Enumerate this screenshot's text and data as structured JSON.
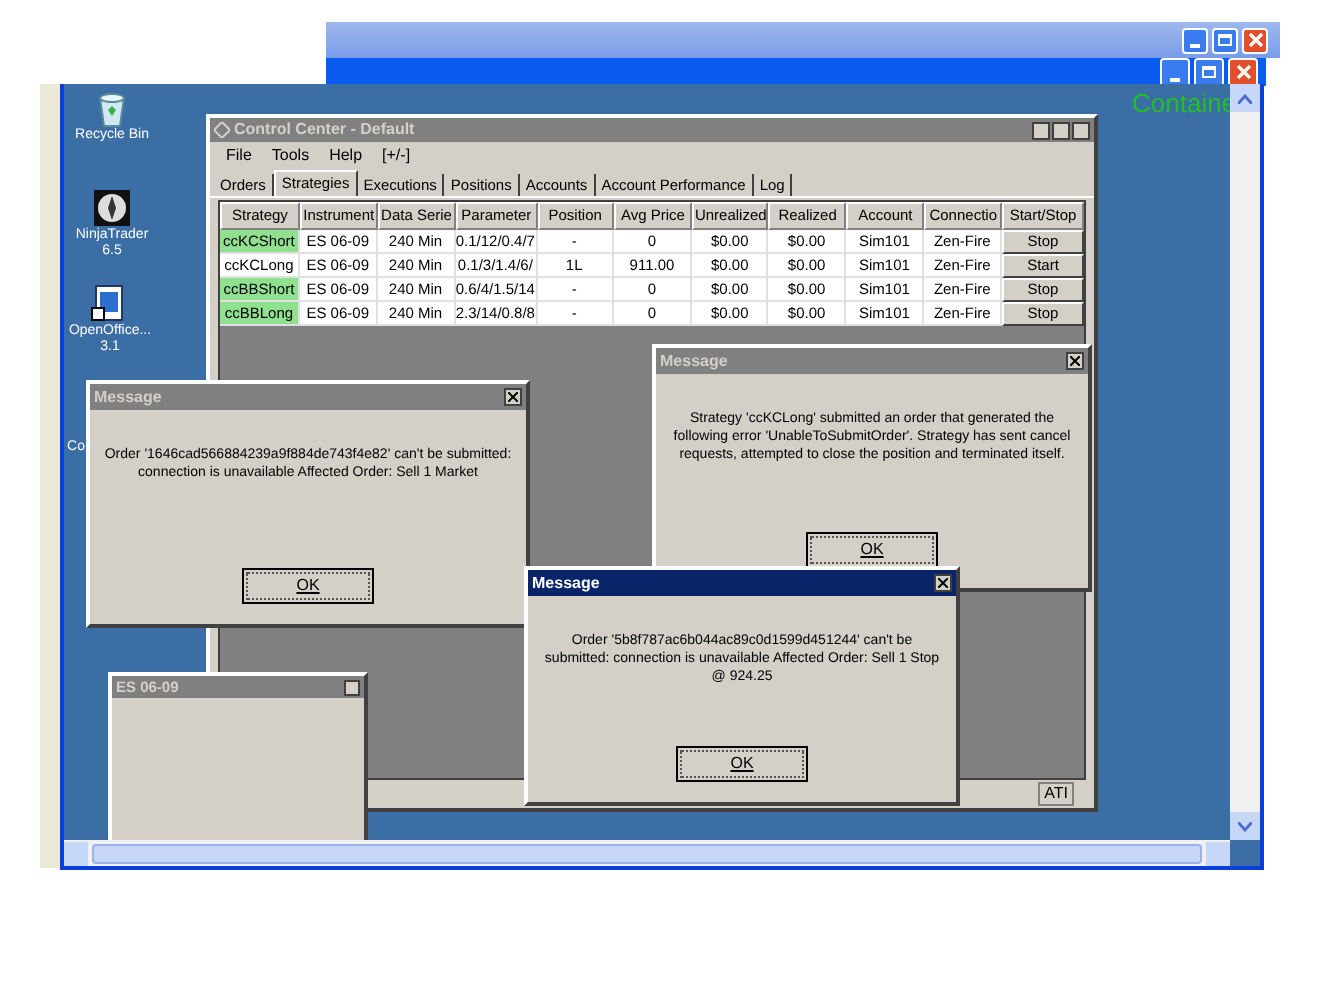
{
  "desktop": {
    "corner_label": "Containe",
    "icons": [
      {
        "label": "Recycle Bin"
      },
      {
        "label": "NinjaTrader 6.5"
      },
      {
        "label": "OpenOffice... 3.1"
      },
      {
        "label": "Co"
      }
    ]
  },
  "control_center": {
    "title": "Control Center - Default",
    "menu": [
      "File",
      "Tools",
      "Help",
      "[+/-]"
    ],
    "tabs": [
      {
        "label": "Orders",
        "selected": false
      },
      {
        "label": "Strategies",
        "selected": true
      },
      {
        "label": "Executions",
        "selected": false
      },
      {
        "label": "Positions",
        "selected": false
      },
      {
        "label": "Accounts",
        "selected": false
      },
      {
        "label": "Account Performance",
        "selected": false
      },
      {
        "label": "Log",
        "selected": false
      }
    ],
    "columns": [
      "Strategy",
      "Instrument",
      "Data Serie",
      "Parameter",
      "Position",
      "Avg Price",
      "Unrealized",
      "Realized",
      "Account",
      "Connectio",
      "Start/Stop"
    ],
    "rows": [
      {
        "running": true,
        "cells": [
          "ccKCShort",
          "ES 06-09",
          "240 Min",
          "0.1/12/0.4/7",
          "-",
          "0",
          "$0.00",
          "$0.00",
          "Sim101",
          "Zen-Fire"
        ],
        "action": "Stop"
      },
      {
        "running": false,
        "cells": [
          "ccKCLong",
          "ES 06-09",
          "240 Min",
          "0.1/3/1.4/6/",
          "1L",
          "911.00",
          "$0.00",
          "$0.00",
          "Sim101",
          "Zen-Fire"
        ],
        "action": "Start"
      },
      {
        "running": true,
        "cells": [
          "ccBBShort",
          "ES 06-09",
          "240 Min",
          "0.6/4/1.5/14",
          "-",
          "0",
          "$0.00",
          "$0.00",
          "Sim101",
          "Zen-Fire"
        ],
        "action": "Stop"
      },
      {
        "running": true,
        "cells": [
          "ccBBLong",
          "ES 06-09",
          "240 Min",
          "2.3/14/0.8/8",
          "-",
          "0",
          "$0.00",
          "$0.00",
          "Sim101",
          "Zen-Fire"
        ],
        "action": "Stop"
      }
    ],
    "status": "ATI"
  },
  "chart_window": {
    "title": "ES 06-09"
  },
  "messages": [
    {
      "title": "Message",
      "active": false,
      "text": "Order '1646cad566884239a9f884de743f4e82' can't be submitted: connection is unavailable Affected Order: Sell 1 Market",
      "button": "OK"
    },
    {
      "title": "Message",
      "active": false,
      "text": "Strategy 'ccKCLong' submitted an order that generated the following error 'UnableToSubmitOrder'. Strategy has sent cancel requests, attempted to close the position and terminated itself.",
      "button": "OK"
    },
    {
      "title": "Message",
      "active": true,
      "text": "Order '5b8f787ac6b044ac89c0d1599d451244' can't be submitted: connection is unavailable Affected Order: Sell 1 Stop @ 924.25",
      "button": "OK"
    }
  ]
}
